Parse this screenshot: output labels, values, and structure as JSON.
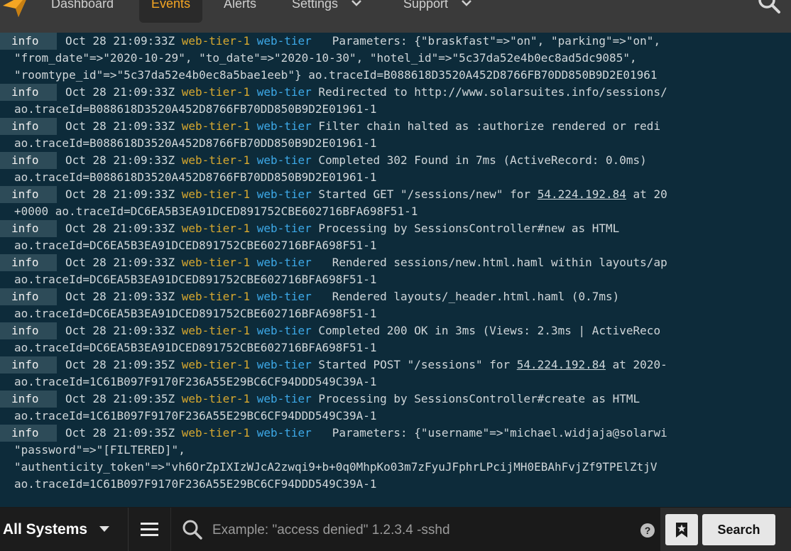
{
  "colors": {
    "accent": "#f5a623",
    "host": "#d7a82f",
    "program": "#3da9e8",
    "log_background": "#0d2b3a",
    "level_background": "#2d4b58"
  },
  "nav": {
    "items": [
      {
        "label": "Dashboard"
      },
      {
        "label": "Events"
      },
      {
        "label": "Alerts"
      },
      {
        "label": "Settings"
      },
      {
        "label": "Support"
      }
    ],
    "active": "Events",
    "search_icon": "search-icon",
    "logo_icon": "logo-icon"
  },
  "log": {
    "entries": [
      {
        "level": "info",
        "lines": [
          [
            {
              "t": "ts",
              "v": "Oct 28 21:09:33Z "
            },
            {
              "t": "host",
              "v": "web-tier-1"
            },
            {
              "t": "ts",
              "v": " "
            },
            {
              "t": "prog",
              "v": "web-tier"
            },
            {
              "t": "msg",
              "v": "   Parameters: {\"braskfast\"=>\"on\", \"parking\"=>\"on\","
            }
          ],
          [
            {
              "t": "msg",
              "v": "\"from_date\"=>\"2020-10-29\", \"to_date\"=>\"2020-10-30\", \"hotel_id\"=>\"5c37da52e4b0ec8ad5dc9085\","
            }
          ],
          [
            {
              "t": "msg",
              "v": "\"roomtype_id\"=>\"5c37da52e4b0ec8a5bae1eeb\"} ao.traceId=B088618D3520A452D8766FB70DD850B9D2E01961"
            }
          ]
        ]
      },
      {
        "level": "info",
        "lines": [
          [
            {
              "t": "ts",
              "v": "Oct 28 21:09:33Z "
            },
            {
              "t": "host",
              "v": "web-tier-1"
            },
            {
              "t": "ts",
              "v": " "
            },
            {
              "t": "prog",
              "v": "web-tier"
            },
            {
              "t": "msg",
              "v": " Redirected to http://www.solarsuites.info/sessions/"
            }
          ],
          [
            {
              "t": "msg",
              "v": "ao.traceId=B088618D3520A452D8766FB70DD850B9D2E01961-1"
            }
          ]
        ]
      },
      {
        "level": "info",
        "lines": [
          [
            {
              "t": "ts",
              "v": "Oct 28 21:09:33Z "
            },
            {
              "t": "host",
              "v": "web-tier-1"
            },
            {
              "t": "ts",
              "v": " "
            },
            {
              "t": "prog",
              "v": "web-tier"
            },
            {
              "t": "msg",
              "v": " Filter chain halted as :authorize rendered or redi"
            }
          ],
          [
            {
              "t": "msg",
              "v": "ao.traceId=B088618D3520A452D8766FB70DD850B9D2E01961-1"
            }
          ]
        ]
      },
      {
        "level": "info",
        "lines": [
          [
            {
              "t": "ts",
              "v": "Oct 28 21:09:33Z "
            },
            {
              "t": "host",
              "v": "web-tier-1"
            },
            {
              "t": "ts",
              "v": " "
            },
            {
              "t": "prog",
              "v": "web-tier"
            },
            {
              "t": "msg",
              "v": " Completed 302 Found in 7ms (ActiveRecord: 0.0ms)"
            }
          ],
          [
            {
              "t": "msg",
              "v": "ao.traceId=B088618D3520A452D8766FB70DD850B9D2E01961-1"
            }
          ]
        ]
      },
      {
        "level": "info",
        "lines": [
          [
            {
              "t": "ts",
              "v": "Oct 28 21:09:33Z "
            },
            {
              "t": "host",
              "v": "web-tier-1"
            },
            {
              "t": "ts",
              "v": " "
            },
            {
              "t": "prog",
              "v": "web-tier"
            },
            {
              "t": "msg",
              "v": " Started GET \"/sessions/new\" for "
            },
            {
              "t": "ip",
              "v": "54.224.192.84"
            },
            {
              "t": "msg",
              "v": " at 20"
            }
          ],
          [
            {
              "t": "msg",
              "v": "+0000 ao.traceId=DC6EA5B3EA91DCED891752CBE602716BFA698F51-1"
            }
          ]
        ]
      },
      {
        "level": "info",
        "lines": [
          [
            {
              "t": "ts",
              "v": "Oct 28 21:09:33Z "
            },
            {
              "t": "host",
              "v": "web-tier-1"
            },
            {
              "t": "ts",
              "v": " "
            },
            {
              "t": "prog",
              "v": "web-tier"
            },
            {
              "t": "msg",
              "v": " Processing by SessionsController#new as HTML"
            }
          ],
          [
            {
              "t": "msg",
              "v": "ao.traceId=DC6EA5B3EA91DCED891752CBE602716BFA698F51-1"
            }
          ]
        ]
      },
      {
        "level": "info",
        "lines": [
          [
            {
              "t": "ts",
              "v": "Oct 28 21:09:33Z "
            },
            {
              "t": "host",
              "v": "web-tier-1"
            },
            {
              "t": "ts",
              "v": " "
            },
            {
              "t": "prog",
              "v": "web-tier"
            },
            {
              "t": "msg",
              "v": "   Rendered sessions/new.html.haml within layouts/ap"
            }
          ],
          [
            {
              "t": "msg",
              "v": "ao.traceId=DC6EA5B3EA91DCED891752CBE602716BFA698F51-1"
            }
          ]
        ]
      },
      {
        "level": "info",
        "lines": [
          [
            {
              "t": "ts",
              "v": "Oct 28 21:09:33Z "
            },
            {
              "t": "host",
              "v": "web-tier-1"
            },
            {
              "t": "ts",
              "v": " "
            },
            {
              "t": "prog",
              "v": "web-tier"
            },
            {
              "t": "msg",
              "v": "   Rendered layouts/_header.html.haml (0.7ms)"
            }
          ],
          [
            {
              "t": "msg",
              "v": "ao.traceId=DC6EA5B3EA91DCED891752CBE602716BFA698F51-1"
            }
          ]
        ]
      },
      {
        "level": "info",
        "lines": [
          [
            {
              "t": "ts",
              "v": "Oct 28 21:09:33Z "
            },
            {
              "t": "host",
              "v": "web-tier-1"
            },
            {
              "t": "ts",
              "v": " "
            },
            {
              "t": "prog",
              "v": "web-tier"
            },
            {
              "t": "msg",
              "v": " Completed 200 OK in 3ms (Views: 2.3ms | ActiveReco"
            }
          ],
          [
            {
              "t": "msg",
              "v": "ao.traceId=DC6EA5B3EA91DCED891752CBE602716BFA698F51-1"
            }
          ]
        ]
      },
      {
        "level": "info",
        "lines": [
          [
            {
              "t": "ts",
              "v": "Oct 28 21:09:35Z "
            },
            {
              "t": "host",
              "v": "web-tier-1"
            },
            {
              "t": "ts",
              "v": " "
            },
            {
              "t": "prog",
              "v": "web-tier"
            },
            {
              "t": "msg",
              "v": " Started POST \"/sessions\" for "
            },
            {
              "t": "ip",
              "v": "54.224.192.84"
            },
            {
              "t": "msg",
              "v": " at 2020-"
            }
          ],
          [
            {
              "t": "msg",
              "v": "ao.traceId=1C61B097F9170F236A55E29BC6CF94DDD549C39A-1"
            }
          ]
        ]
      },
      {
        "level": "info",
        "lines": [
          [
            {
              "t": "ts",
              "v": "Oct 28 21:09:35Z "
            },
            {
              "t": "host",
              "v": "web-tier-1"
            },
            {
              "t": "ts",
              "v": " "
            },
            {
              "t": "prog",
              "v": "web-tier"
            },
            {
              "t": "msg",
              "v": " Processing by SessionsController#create as HTML"
            }
          ],
          [
            {
              "t": "msg",
              "v": "ao.traceId=1C61B097F9170F236A55E29BC6CF94DDD549C39A-1"
            }
          ]
        ]
      },
      {
        "level": "info",
        "lines": [
          [
            {
              "t": "ts",
              "v": "Oct 28 21:09:35Z "
            },
            {
              "t": "host",
              "v": "web-tier-1"
            },
            {
              "t": "ts",
              "v": " "
            },
            {
              "t": "prog",
              "v": "web-tier"
            },
            {
              "t": "msg",
              "v": "   Parameters: {\"username\"=>\"michael.widjaja@solarwi"
            }
          ],
          [
            {
              "t": "msg",
              "v": "\"password\"=>\"[FILTERED]\","
            }
          ],
          [
            {
              "t": "msg",
              "v": "\"authenticity_token\"=>\"vh6OrZpIXIzWJcA2zwqi9+b+0q0MhpKo03m7zFyuJFphrLPcijMH0EBAhFvjZf9TPElZtjV"
            }
          ],
          [
            {
              "t": "msg",
              "v": "ao.traceId=1C61B097F9170F236A55E29BC6CF94DDD549C39A-1"
            }
          ]
        ]
      }
    ]
  },
  "bottom": {
    "systems_label": "All Systems",
    "systems_caret_icon": "caret-down-icon",
    "menu_icon": "hamburger-menu-icon",
    "search_icon": "search-icon",
    "search_placeholder": "Example: \"access denied\" 1.2.3.4 -sshd",
    "search_value": "",
    "help_label": "?",
    "saved_search_icon": "bookmark-icon",
    "search_button_label": "Search"
  }
}
